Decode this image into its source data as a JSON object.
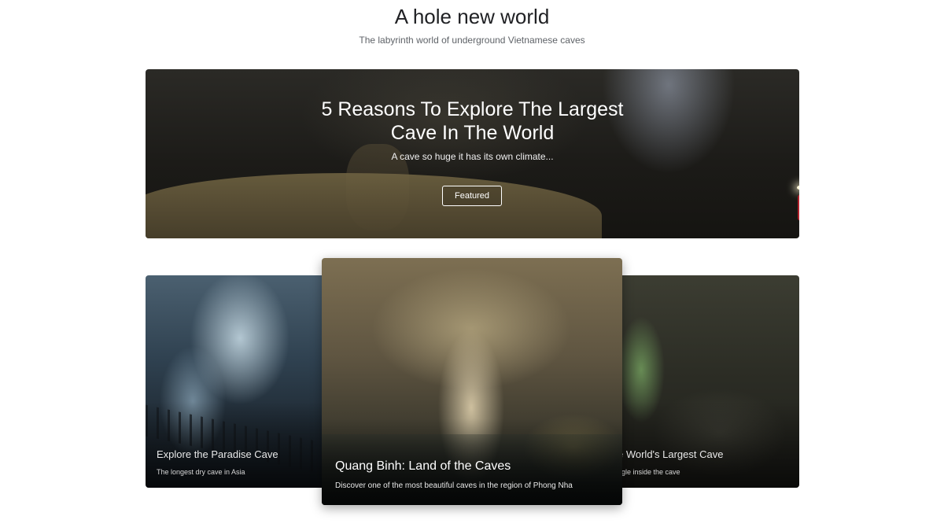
{
  "header": {
    "title": "A hole new world",
    "subtitle": "The labyrinth world of underground Vietnamese caves"
  },
  "hero": {
    "title_line1": "5 Reasons To Explore The Largest",
    "title_line2": "Cave In The World",
    "description": "A cave so huge it has its own climate...",
    "button_label": "Featured"
  },
  "cards": [
    {
      "title": "Explore the Paradise Cave",
      "description": "The longest dry cave in Asia"
    },
    {
      "title": "Quang Binh: Land of the Caves",
      "description": "Discover one of the most beautiful caves in the region of Phong Nha"
    },
    {
      "title": "e World's Largest Cave",
      "description": "ngle inside the cave"
    }
  ],
  "colors": {
    "title_text": "#202124",
    "subtitle_text": "#5f6368",
    "accent_explorer": "#b0202a"
  }
}
